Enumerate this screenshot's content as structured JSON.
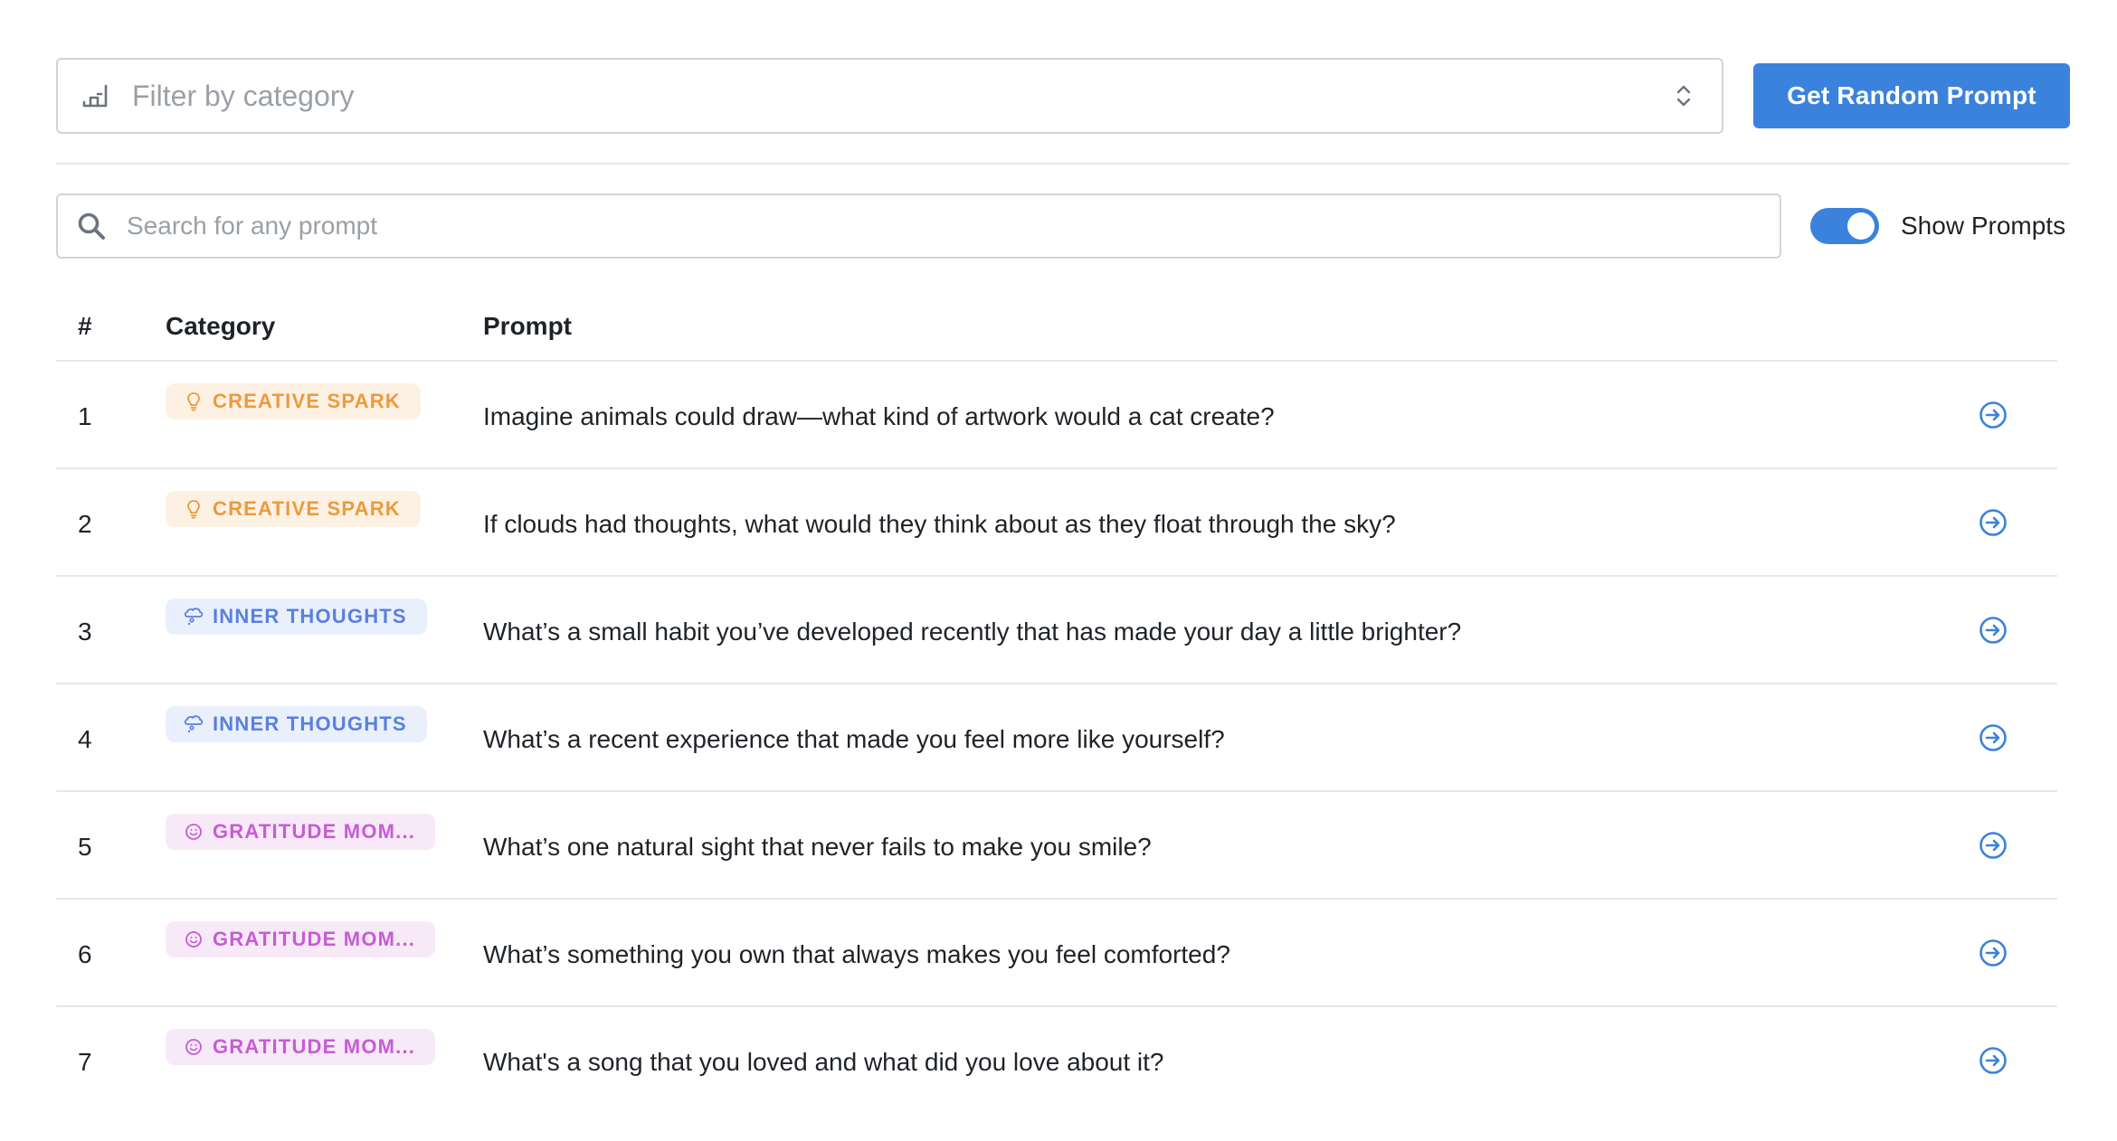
{
  "filter": {
    "placeholder": "Filter by category",
    "icon": "filter-sort-icon"
  },
  "random_button": {
    "label": "Get Random Prompt"
  },
  "search": {
    "placeholder": "Search for any prompt",
    "value": ""
  },
  "toggle": {
    "label": "Show Prompts",
    "on": true
  },
  "table": {
    "headers": {
      "num": "#",
      "category": "Category",
      "prompt": "Prompt"
    },
    "rows": [
      {
        "num": "1",
        "category": "CREATIVE SPARK",
        "category_icon": "lightbulb-icon",
        "prompt": "Imagine animals could draw—what kind of artwork would a cat create?"
      },
      {
        "num": "2",
        "category": "CREATIVE SPARK",
        "category_icon": "lightbulb-icon",
        "prompt": "If clouds had thoughts, what would they think about as they float through the sky?"
      },
      {
        "num": "3",
        "category": "INNER THOUGHTS",
        "category_icon": "thought-bubble-icon",
        "prompt": "What’s a small habit you’ve developed recently that has made your day a little brighter?"
      },
      {
        "num": "4",
        "category": "INNER THOUGHTS",
        "category_icon": "thought-bubble-icon",
        "prompt": "What’s a recent experience that made you feel more like yourself?"
      },
      {
        "num": "5",
        "category": "GRATITUDE MOM...",
        "category_icon": "smiley-icon",
        "prompt": "What’s one natural sight that never fails to make you smile?"
      },
      {
        "num": "6",
        "category": "GRATITUDE MOM...",
        "category_icon": "smiley-icon",
        "prompt": "What’s something you own that always makes you feel comforted?"
      },
      {
        "num": "7",
        "category": "GRATITUDE MOM...",
        "category_icon": "smiley-icon",
        "prompt": "What's a song that you loved and what did you love about it?"
      }
    ]
  },
  "colors": {
    "accent": "#3b82dc",
    "creative": "#ee9a3a",
    "inner": "#5a7fe0",
    "gratitude": "#c75bd6"
  }
}
